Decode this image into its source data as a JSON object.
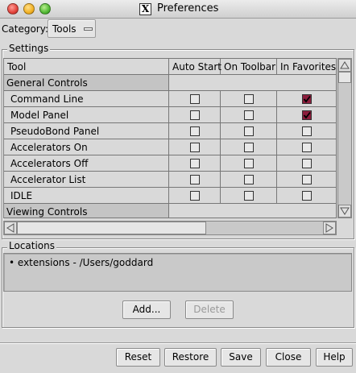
{
  "window": {
    "title": "Preferences"
  },
  "category": {
    "label": "Category:",
    "value": "Tools"
  },
  "settings": {
    "label": "Settings",
    "columns": [
      "Tool",
      "Auto Start",
      "On Toolbar",
      "In Favorites"
    ],
    "rows": [
      {
        "type": "group",
        "name": "General Controls"
      },
      {
        "type": "item",
        "name": "Command Line",
        "auto_start": false,
        "on_toolbar": false,
        "in_favorites": true
      },
      {
        "type": "item",
        "name": "Model Panel",
        "auto_start": false,
        "on_toolbar": false,
        "in_favorites": true
      },
      {
        "type": "item",
        "name": "PseudoBond Panel",
        "auto_start": false,
        "on_toolbar": false,
        "in_favorites": false
      },
      {
        "type": "item",
        "name": "Accelerators On",
        "auto_start": false,
        "on_toolbar": false,
        "in_favorites": false
      },
      {
        "type": "item",
        "name": "Accelerators Off",
        "auto_start": false,
        "on_toolbar": false,
        "in_favorites": false
      },
      {
        "type": "item",
        "name": "Accelerator List",
        "auto_start": false,
        "on_toolbar": false,
        "in_favorites": false
      },
      {
        "type": "item",
        "name": "IDLE",
        "auto_start": false,
        "on_toolbar": false,
        "in_favorites": false
      },
      {
        "type": "group",
        "name": "Viewing Controls"
      }
    ]
  },
  "locations": {
    "label": "Locations",
    "items": [
      "extensions - /Users/goddard"
    ],
    "add_label": "Add...",
    "delete_label": "Delete"
  },
  "footer": {
    "reset_label": "Reset",
    "restore_label": "Restore",
    "save_label": "Save",
    "close_label": "Close",
    "help_label": "Help"
  },
  "colors": {
    "checked": "#8c1d3c",
    "background": "#d9d9d9"
  }
}
